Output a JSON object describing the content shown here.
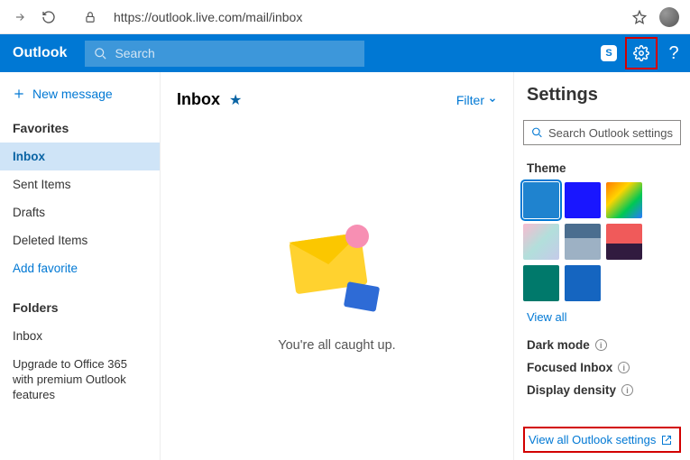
{
  "browser": {
    "url": "https://outlook.live.com/mail/inbox"
  },
  "appbar": {
    "brand": "Outlook",
    "search_placeholder": "Search",
    "skype_badge": "S"
  },
  "sidebar": {
    "new_message": "New message",
    "favorites_header": "Favorites",
    "favorites": [
      {
        "label": "Inbox",
        "selected": true
      },
      {
        "label": "Sent Items",
        "selected": false
      },
      {
        "label": "Drafts",
        "selected": false
      },
      {
        "label": "Deleted Items",
        "selected": false
      }
    ],
    "add_favorite": "Add favorite",
    "folders_header": "Folders",
    "folders": [
      {
        "label": "Inbox"
      }
    ],
    "upgrade_text": "Upgrade to Office 365 with premium Outlook features"
  },
  "content": {
    "title": "Inbox",
    "filter_label": "Filter",
    "empty_message": "You're all caught up."
  },
  "settings": {
    "title": "Settings",
    "search_placeholder": "Search Outlook settings",
    "theme_label": "Theme",
    "themes": [
      {
        "name": "blue-default",
        "css": "background:#1f83cf;",
        "selected": true
      },
      {
        "name": "blue-bright",
        "css": "background:#1916ff;"
      },
      {
        "name": "rainbow",
        "css": "background:linear-gradient(135deg,#ff7b00,#ffd400,#00c853,#2979ff);"
      },
      {
        "name": "gradient-pastel",
        "css": "background:linear-gradient(135deg,#f8bbd0,#b2dfdb,#c5cae9);"
      },
      {
        "name": "mountains",
        "css": "background:linear-gradient(#4b6e8f 40%,#9db1c4 40%);"
      },
      {
        "name": "sunset",
        "css": "background:linear-gradient(#f05a5a 55%,#311b3f 55%);"
      },
      {
        "name": "circuits",
        "css": "background:#00796b;"
      },
      {
        "name": "navigation",
        "css": "background:#1565c0;"
      }
    ],
    "view_all_themes": "View all",
    "dark_mode": "Dark mode",
    "focused_inbox": "Focused Inbox",
    "display_density": "Display density",
    "view_all_settings": "View all Outlook settings"
  }
}
